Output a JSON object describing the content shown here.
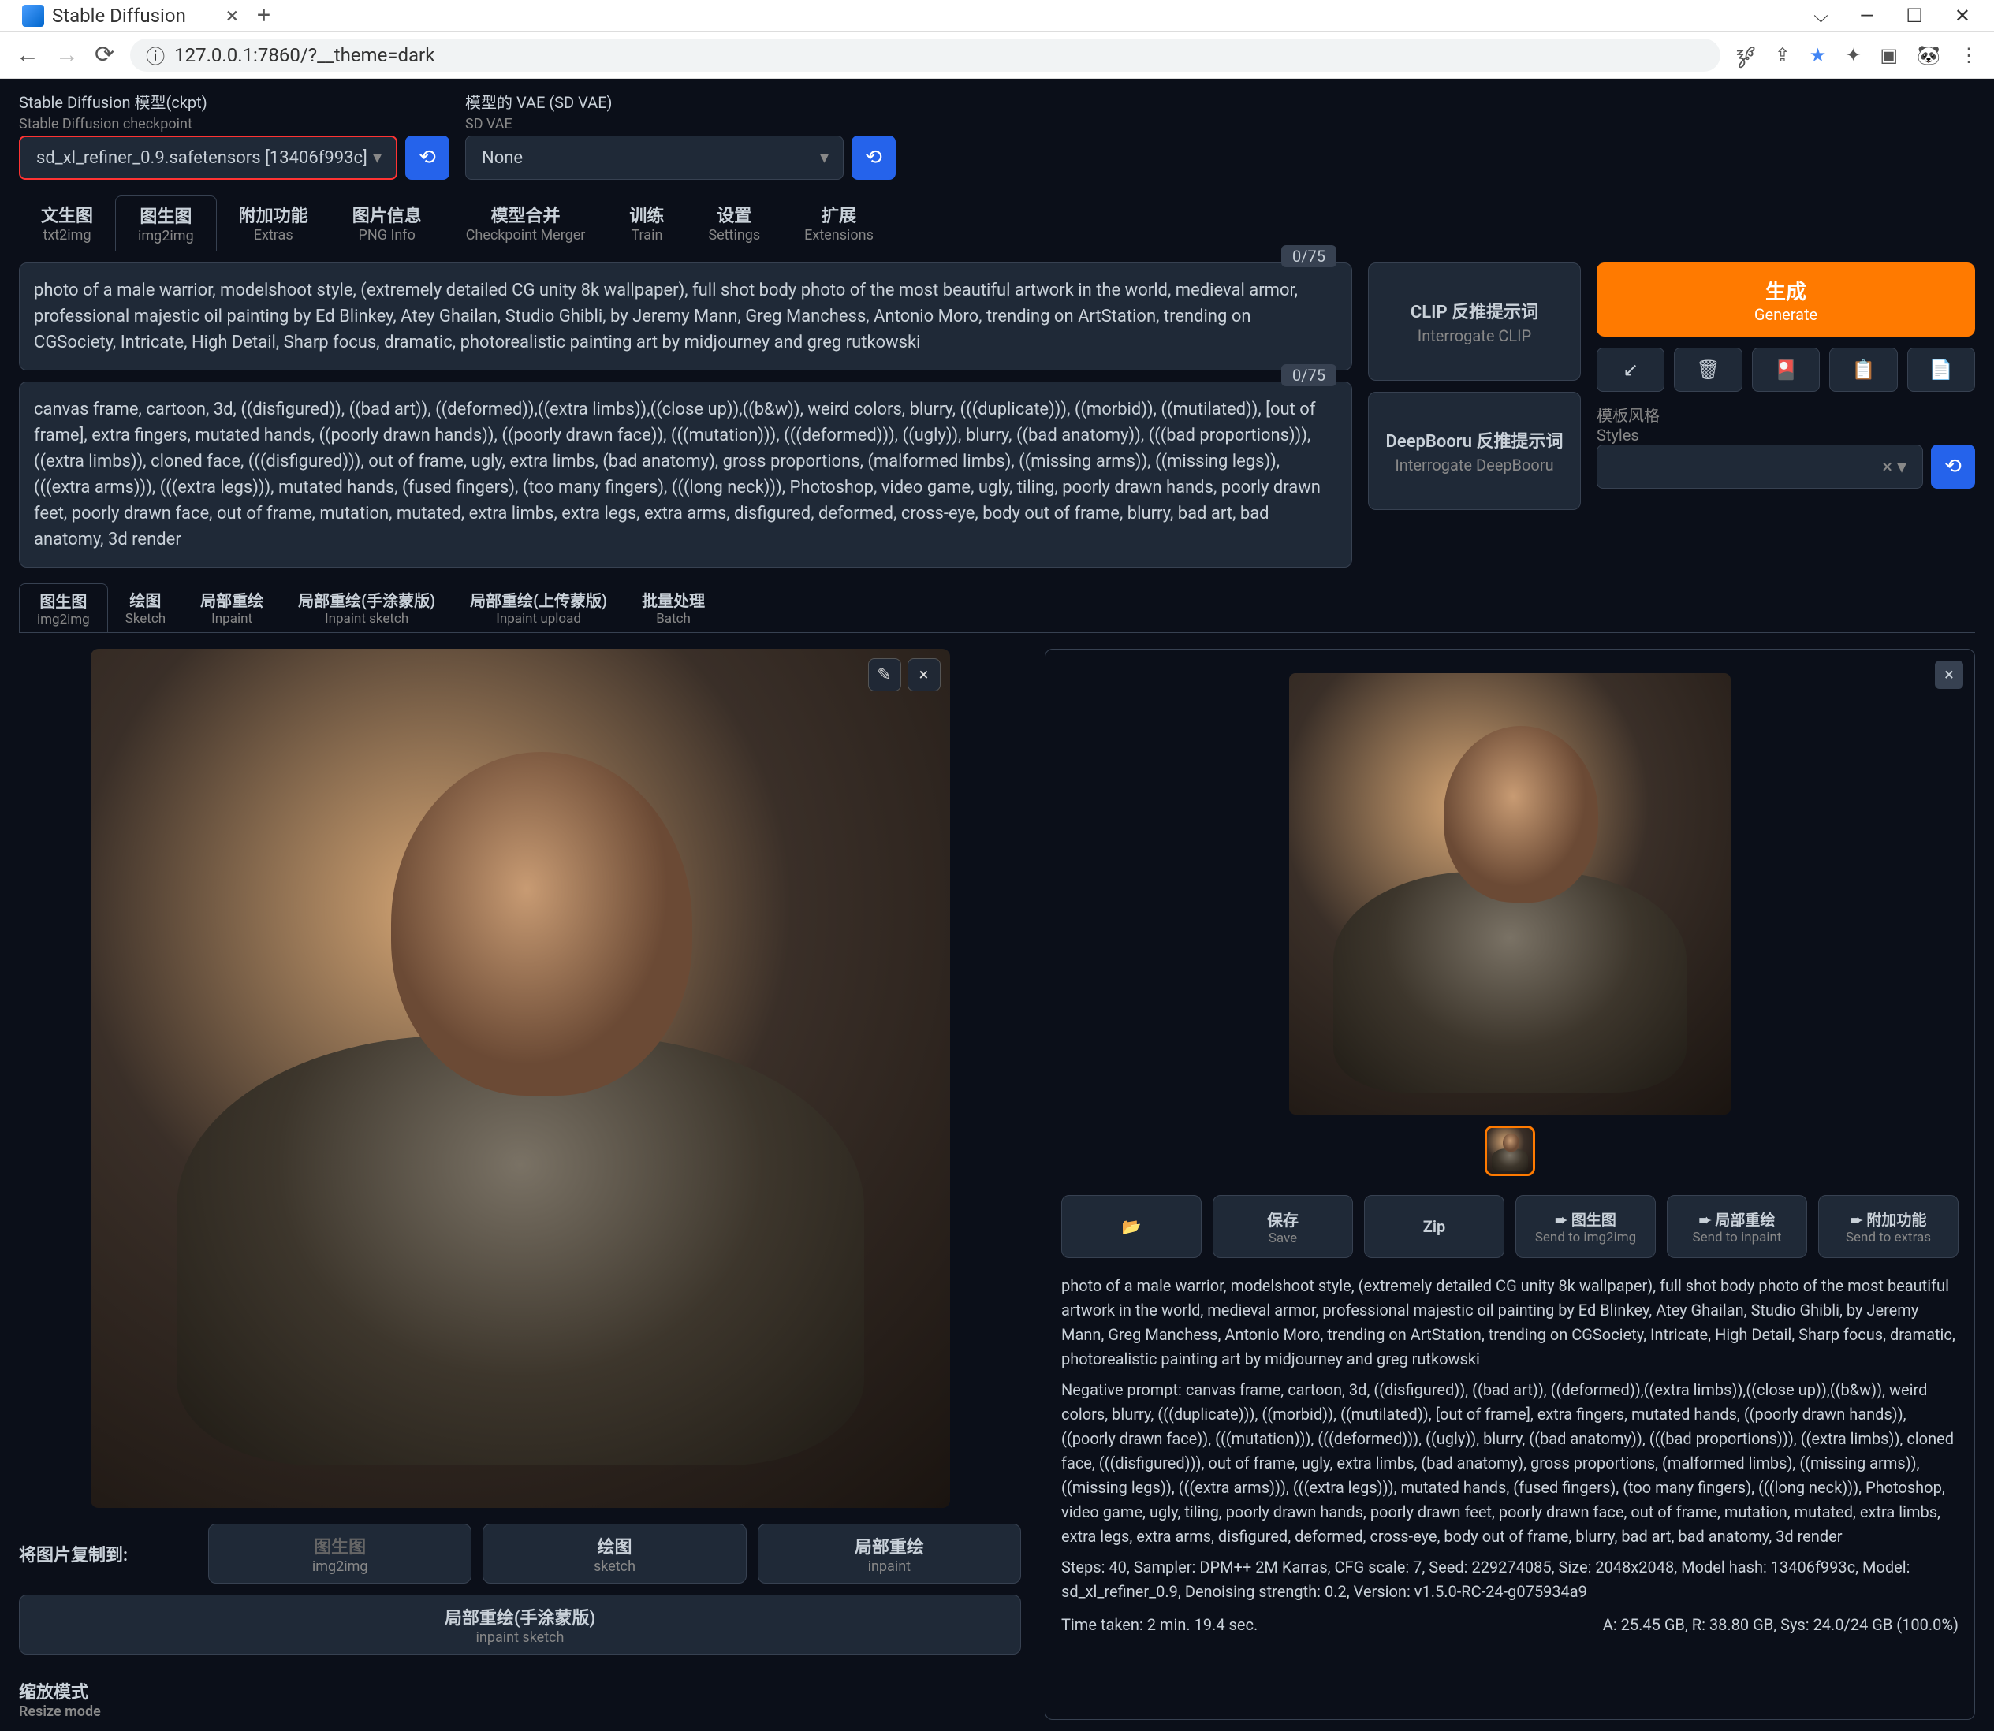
{
  "browser": {
    "tab_title": "Stable Diffusion",
    "url": "127.0.0.1:7860/?__theme=dark"
  },
  "checkpoint": {
    "label_cn": "Stable Diffusion 模型(ckpt)",
    "label_en": "Stable Diffusion checkpoint",
    "value": "sd_xl_refiner_0.9.safetensors [13406f993c]"
  },
  "vae": {
    "label_cn": "模型的 VAE (SD VAE)",
    "label_en": "SD VAE",
    "value": "None"
  },
  "main_tabs": [
    {
      "cn": "文生图",
      "en": "txt2img"
    },
    {
      "cn": "图生图",
      "en": "img2img"
    },
    {
      "cn": "附加功能",
      "en": "Extras"
    },
    {
      "cn": "图片信息",
      "en": "PNG Info"
    },
    {
      "cn": "模型合并",
      "en": "Checkpoint Merger"
    },
    {
      "cn": "训练",
      "en": "Train"
    },
    {
      "cn": "设置",
      "en": "Settings"
    },
    {
      "cn": "扩展",
      "en": "Extensions"
    }
  ],
  "prompt": {
    "counter": "0/75",
    "text": "photo of a male warrior, modelshoot style, (extremely detailed CG unity 8k wallpaper), full shot body photo of the most beautiful artwork in the world, medieval armor, professional majestic oil painting by Ed Blinkey, Atey Ghailan, Studio Ghibli, by Jeremy Mann, Greg Manchess, Antonio Moro, trending on ArtStation, trending on CGSociety, Intricate, High Detail, Sharp focus, dramatic, photorealistic painting art by midjourney and greg rutkowski"
  },
  "neg_prompt": {
    "counter": "0/75",
    "text": "canvas frame, cartoon, 3d, ((disfigured)), ((bad art)), ((deformed)),((extra limbs)),((close up)),((b&w)), weird colors, blurry, (((duplicate))), ((morbid)), ((mutilated)), [out of frame], extra fingers, mutated hands, ((poorly drawn hands)), ((poorly drawn face)), (((mutation))), (((deformed))), ((ugly)), blurry, ((bad anatomy)), (((bad proportions))), ((extra limbs)), cloned face, (((disfigured))), out of frame, ugly, extra limbs, (bad anatomy), gross proportions, (malformed limbs), ((missing arms)), ((missing legs)), (((extra arms))), (((extra legs))), mutated hands, (fused fingers), (too many fingers), (((long neck))), Photoshop, video game, ugly, tiling, poorly drawn hands, poorly drawn feet, poorly drawn face, out of frame, mutation, mutated, extra limbs, extra legs, extra arms, disfigured, deformed, cross-eye, body out of frame, blurry, bad art, bad anatomy, 3d render"
  },
  "clip_btn": {
    "cn": "CLIP      反推提示词",
    "en": "Interrogate CLIP"
  },
  "deep_btn": {
    "cn": "DeepBooru 反推提示词",
    "en": "Interrogate DeepBooru"
  },
  "generate": {
    "cn": "生成",
    "en": "Generate"
  },
  "styles": {
    "label_cn": "模板风格",
    "label_en": "Styles",
    "clear": "× ▾"
  },
  "sub_tabs": [
    {
      "cn": "图生图",
      "en": "img2img"
    },
    {
      "cn": "绘图",
      "en": "Sketch"
    },
    {
      "cn": "局部重绘",
      "en": "Inpaint"
    },
    {
      "cn": "局部重绘(手涂蒙版)",
      "en": "Inpaint sketch"
    },
    {
      "cn": "局部重绘(上传蒙版)",
      "en": "Inpaint upload"
    },
    {
      "cn": "批量处理",
      "en": "Batch"
    }
  ],
  "copy_label": "将图片复制到:",
  "copy_btns": [
    {
      "cn": "图生图",
      "en": "img2img",
      "dim": true
    },
    {
      "cn": "绘图",
      "en": "sketch"
    },
    {
      "cn": "局部重绘",
      "en": "inpaint"
    },
    {
      "cn": "局部重绘(手涂蒙版)",
      "en": "inpaint sketch"
    }
  ],
  "resize": {
    "cn": "缩放模式",
    "en": "Resize mode"
  },
  "actions": [
    {
      "cn": "📂",
      "en": ""
    },
    {
      "cn": "保存",
      "en": "Save"
    },
    {
      "cn": "Zip",
      "en": ""
    },
    {
      "cn": "➨ 图生图",
      "en": "Send to img2img"
    },
    {
      "cn": "➨ 局部重绘",
      "en": "Send to inpaint"
    },
    {
      "cn": "➨ 附加功能",
      "en": "Send to extras"
    }
  ],
  "result": {
    "prompt": "photo of a male warrior, modelshoot style, (extremely detailed CG unity 8k wallpaper), full shot body photo of the most beautiful artwork in the world, medieval armor, professional majestic oil painting by Ed Blinkey, Atey Ghailan, Studio Ghibli, by Jeremy Mann, Greg Manchess, Antonio Moro, trending on ArtStation, trending on CGSociety, Intricate, High Detail, Sharp focus, dramatic, photorealistic painting art by midjourney and greg rutkowski",
    "neg": "Negative prompt: canvas frame, cartoon, 3d, ((disfigured)), ((bad art)), ((deformed)),((extra limbs)),((close up)),((b&w)), weird colors, blurry, (((duplicate))), ((morbid)), ((mutilated)), [out of frame], extra fingers, mutated hands, ((poorly drawn hands)), ((poorly drawn face)), (((mutation))), (((deformed))), ((ugly)), blurry, ((bad anatomy)), (((bad proportions))), ((extra limbs)), cloned face, (((disfigured))), out of frame, ugly, extra limbs, (bad anatomy), gross proportions, (malformed limbs), ((missing arms)), ((missing legs)), (((extra arms))), (((extra legs))), mutated hands, (fused fingers), (too many fingers), (((long neck))), Photoshop, video game, ugly, tiling, poorly drawn hands, poorly drawn feet, poorly drawn face, out of frame, mutation, mutated, extra limbs, extra legs, extra arms, disfigured, deformed, cross-eye, body out of frame, blurry, bad art, bad anatomy, 3d render",
    "params": "Steps: 40, Sampler: DPM++ 2M Karras, CFG scale: 7, Seed: 229274085, Size: 2048x2048, Model hash: 13406f993c, Model: sd_xl_refiner_0.9, Denoising strength: 0.2, Version: v1.5.0-RC-24-g075934a9",
    "time": "Time taken: 2 min. 19.4 sec.",
    "mem": "A: 25.45 GB, R: 38.80 GB, Sys: 24.0/24 GB (100.0%)"
  }
}
